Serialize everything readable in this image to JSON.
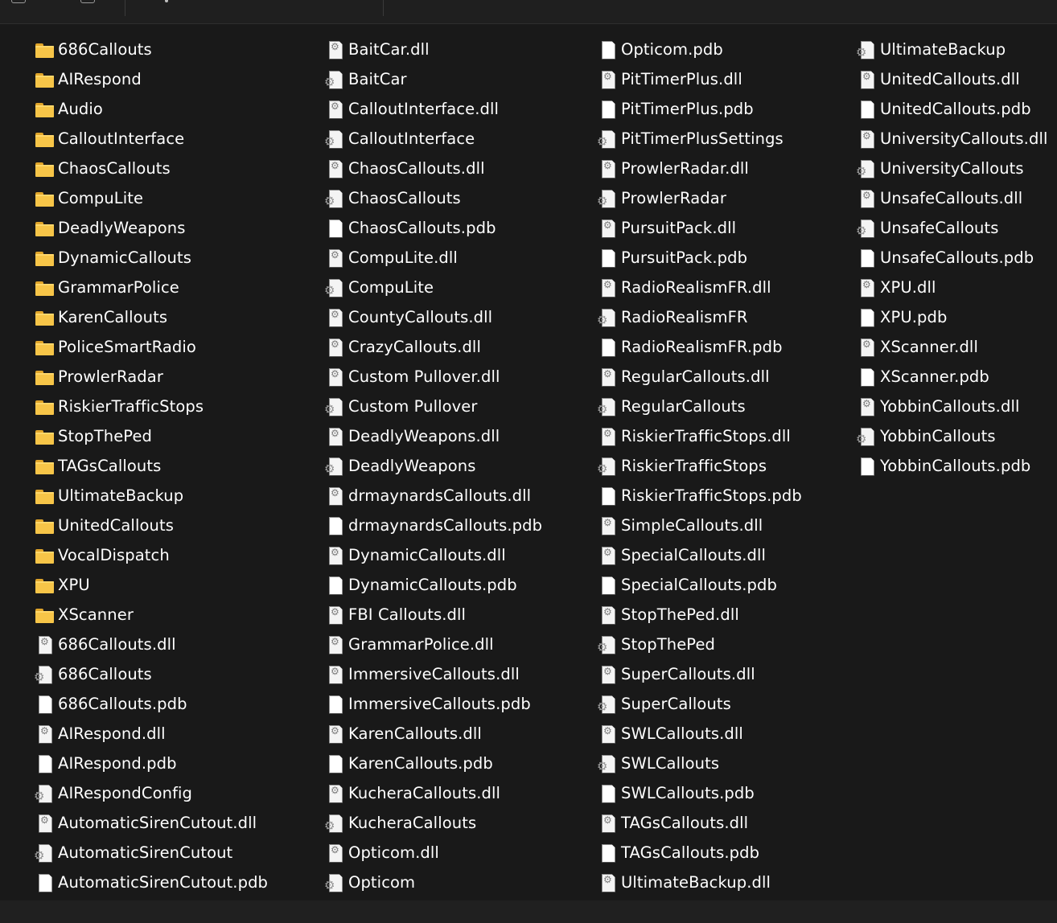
{
  "columns": [
    [
      {
        "type": "folder",
        "name": "686Callouts"
      },
      {
        "type": "folder",
        "name": "AIRespond"
      },
      {
        "type": "folder",
        "name": "Audio"
      },
      {
        "type": "folder",
        "name": "CalloutInterface"
      },
      {
        "type": "folder",
        "name": "ChaosCallouts"
      },
      {
        "type": "folder",
        "name": "CompuLite"
      },
      {
        "type": "folder",
        "name": "DeadlyWeapons"
      },
      {
        "type": "folder",
        "name": "DynamicCallouts"
      },
      {
        "type": "folder",
        "name": "GrammarPolice"
      },
      {
        "type": "folder",
        "name": "KarenCallouts"
      },
      {
        "type": "folder",
        "name": "PoliceSmartRadio"
      },
      {
        "type": "folder",
        "name": "ProwlerRadar"
      },
      {
        "type": "folder",
        "name": "RiskierTrafficStops"
      },
      {
        "type": "folder",
        "name": "StopThePed"
      },
      {
        "type": "folder",
        "name": "TAGsCallouts"
      },
      {
        "type": "folder",
        "name": "UltimateBackup"
      },
      {
        "type": "folder",
        "name": "UnitedCallouts"
      },
      {
        "type": "folder",
        "name": "VocalDispatch"
      },
      {
        "type": "folder",
        "name": "XPU"
      },
      {
        "type": "folder",
        "name": "XScanner"
      },
      {
        "type": "dll",
        "name": "686Callouts.dll"
      },
      {
        "type": "config",
        "name": "686Callouts"
      },
      {
        "type": "file",
        "name": "686Callouts.pdb"
      },
      {
        "type": "dll",
        "name": "AIRespond.dll"
      },
      {
        "type": "file",
        "name": "AIRespond.pdb"
      },
      {
        "type": "config",
        "name": "AIRespondConfig"
      },
      {
        "type": "dll",
        "name": "AutomaticSirenCutout.dll"
      },
      {
        "type": "config",
        "name": "AutomaticSirenCutout"
      },
      {
        "type": "file",
        "name": "AutomaticSirenCutout.pdb"
      }
    ],
    [
      {
        "type": "dll",
        "name": "BaitCar.dll"
      },
      {
        "type": "config",
        "name": "BaitCar"
      },
      {
        "type": "dll",
        "name": "CalloutInterface.dll"
      },
      {
        "type": "config",
        "name": "CalloutInterface"
      },
      {
        "type": "dll",
        "name": "ChaosCallouts.dll"
      },
      {
        "type": "config",
        "name": "ChaosCallouts"
      },
      {
        "type": "file",
        "name": "ChaosCallouts.pdb"
      },
      {
        "type": "dll",
        "name": "CompuLite.dll"
      },
      {
        "type": "config",
        "name": "CompuLite"
      },
      {
        "type": "dll",
        "name": "CountyCallouts.dll"
      },
      {
        "type": "dll",
        "name": "CrazyCallouts.dll"
      },
      {
        "type": "dll",
        "name": "Custom Pullover.dll"
      },
      {
        "type": "config",
        "name": "Custom Pullover"
      },
      {
        "type": "dll",
        "name": "DeadlyWeapons.dll"
      },
      {
        "type": "config",
        "name": "DeadlyWeapons"
      },
      {
        "type": "dll",
        "name": "drmaynardsCallouts.dll"
      },
      {
        "type": "file",
        "name": "drmaynardsCallouts.pdb"
      },
      {
        "type": "dll",
        "name": "DynamicCallouts.dll"
      },
      {
        "type": "file",
        "name": "DynamicCallouts.pdb"
      },
      {
        "type": "dll",
        "name": "FBI Callouts.dll"
      },
      {
        "type": "dll",
        "name": "GrammarPolice.dll"
      },
      {
        "type": "dll",
        "name": "ImmersiveCallouts.dll"
      },
      {
        "type": "file",
        "name": "ImmersiveCallouts.pdb"
      },
      {
        "type": "dll",
        "name": "KarenCallouts.dll"
      },
      {
        "type": "file",
        "name": "KarenCallouts.pdb"
      },
      {
        "type": "dll",
        "name": "KucheraCallouts.dll"
      },
      {
        "type": "config",
        "name": "KucheraCallouts"
      },
      {
        "type": "dll",
        "name": "Opticom.dll"
      },
      {
        "type": "config",
        "name": "Opticom"
      }
    ],
    [
      {
        "type": "file",
        "name": "Opticom.pdb"
      },
      {
        "type": "dll",
        "name": "PitTimerPlus.dll"
      },
      {
        "type": "file",
        "name": "PitTimerPlus.pdb"
      },
      {
        "type": "config",
        "name": "PitTimerPlusSettings"
      },
      {
        "type": "dll",
        "name": "ProwlerRadar.dll"
      },
      {
        "type": "config",
        "name": "ProwlerRadar"
      },
      {
        "type": "dll",
        "name": "PursuitPack.dll"
      },
      {
        "type": "file",
        "name": "PursuitPack.pdb"
      },
      {
        "type": "dll",
        "name": "RadioRealismFR.dll"
      },
      {
        "type": "config",
        "name": "RadioRealismFR"
      },
      {
        "type": "file",
        "name": "RadioRealismFR.pdb"
      },
      {
        "type": "dll",
        "name": "RegularCallouts.dll"
      },
      {
        "type": "config",
        "name": "RegularCallouts"
      },
      {
        "type": "dll",
        "name": "RiskierTrafficStops.dll"
      },
      {
        "type": "config",
        "name": "RiskierTrafficStops"
      },
      {
        "type": "file",
        "name": "RiskierTrafficStops.pdb"
      },
      {
        "type": "dll",
        "name": "SimpleCallouts.dll"
      },
      {
        "type": "dll",
        "name": "SpecialCallouts.dll"
      },
      {
        "type": "file",
        "name": "SpecialCallouts.pdb"
      },
      {
        "type": "dll",
        "name": "StopThePed.dll"
      },
      {
        "type": "config",
        "name": "StopThePed"
      },
      {
        "type": "dll",
        "name": "SuperCallouts.dll"
      },
      {
        "type": "config",
        "name": "SuperCallouts"
      },
      {
        "type": "dll",
        "name": "SWLCallouts.dll"
      },
      {
        "type": "config",
        "name": "SWLCallouts"
      },
      {
        "type": "file",
        "name": "SWLCallouts.pdb"
      },
      {
        "type": "dll",
        "name": "TAGsCallouts.dll"
      },
      {
        "type": "file",
        "name": "TAGsCallouts.pdb"
      },
      {
        "type": "dll",
        "name": "UltimateBackup.dll"
      }
    ],
    [
      {
        "type": "config",
        "name": "UltimateBackup"
      },
      {
        "type": "dll",
        "name": "UnitedCallouts.dll"
      },
      {
        "type": "file",
        "name": "UnitedCallouts.pdb"
      },
      {
        "type": "dll",
        "name": "UniversityCallouts.dll"
      },
      {
        "type": "config",
        "name": "UniversityCallouts"
      },
      {
        "type": "dll",
        "name": "UnsafeCallouts.dll"
      },
      {
        "type": "config",
        "name": "UnsafeCallouts"
      },
      {
        "type": "file",
        "name": "UnsafeCallouts.pdb"
      },
      {
        "type": "dll",
        "name": "XPU.dll"
      },
      {
        "type": "file",
        "name": "XPU.pdb"
      },
      {
        "type": "dll",
        "name": "XScanner.dll"
      },
      {
        "type": "file",
        "name": "XScanner.pdb"
      },
      {
        "type": "dll",
        "name": "YobbinCallouts.dll"
      },
      {
        "type": "config",
        "name": "YobbinCallouts"
      },
      {
        "type": "file",
        "name": "YobbinCallouts.pdb"
      }
    ]
  ],
  "icons": {
    "folder": "folder-icon",
    "dll": "dll-file-icon",
    "config": "config-file-icon",
    "file": "file-icon"
  },
  "colors": {
    "background": "#191919",
    "text": "#ffffff",
    "folder": "#f7c548"
  }
}
